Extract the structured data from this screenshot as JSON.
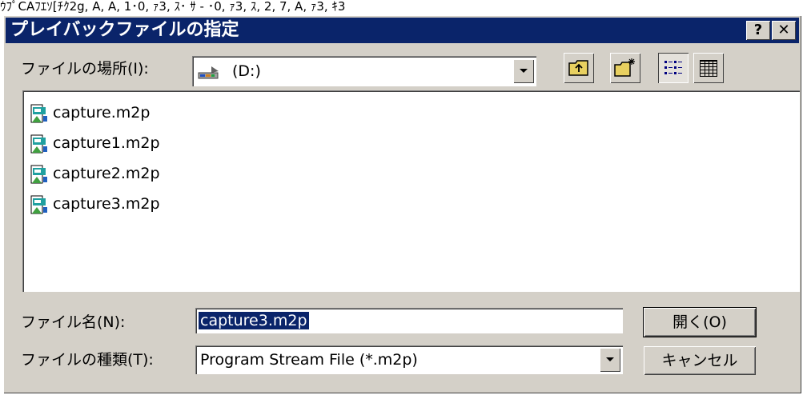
{
  "garbled_header": "ｳﾌﾟCAﾌｴｿ[ﾁｸ2g, A, A, 1･0, ｧ3, ｽ･ ｻ - ･0, ｧ3, ｽ, 2, 7, A, ｧ3, ｷ3",
  "window": {
    "title": "プレイバックファイルの指定",
    "help_label": "?",
    "close_label": "✕"
  },
  "location": {
    "label": "ファイルの場所(I):",
    "value": "(D:)",
    "drive_icon": "drive-icon"
  },
  "toolbar": {
    "icons": [
      "up-folder-icon",
      "new-folder-icon",
      "list-view-icon",
      "details-view-icon"
    ]
  },
  "files": [
    {
      "name": "capture.m2p",
      "icon": "media-file-icon"
    },
    {
      "name": "capture1.m2p",
      "icon": "media-file-icon"
    },
    {
      "name": "capture2.m2p",
      "icon": "media-file-icon"
    },
    {
      "name": "capture3.m2p",
      "icon": "media-file-icon"
    }
  ],
  "filename": {
    "label": "ファイル名(N):",
    "value": "capture3.m2p"
  },
  "filetype": {
    "label": "ファイルの種類(T):",
    "value": "Program Stream File (*.m2p)"
  },
  "buttons": {
    "open": "開く(O)",
    "cancel": "キャンセル"
  },
  "colors": {
    "title_bar": "#0a246a",
    "dialog_face": "#d4d0c8",
    "selection": "#0a246a"
  }
}
